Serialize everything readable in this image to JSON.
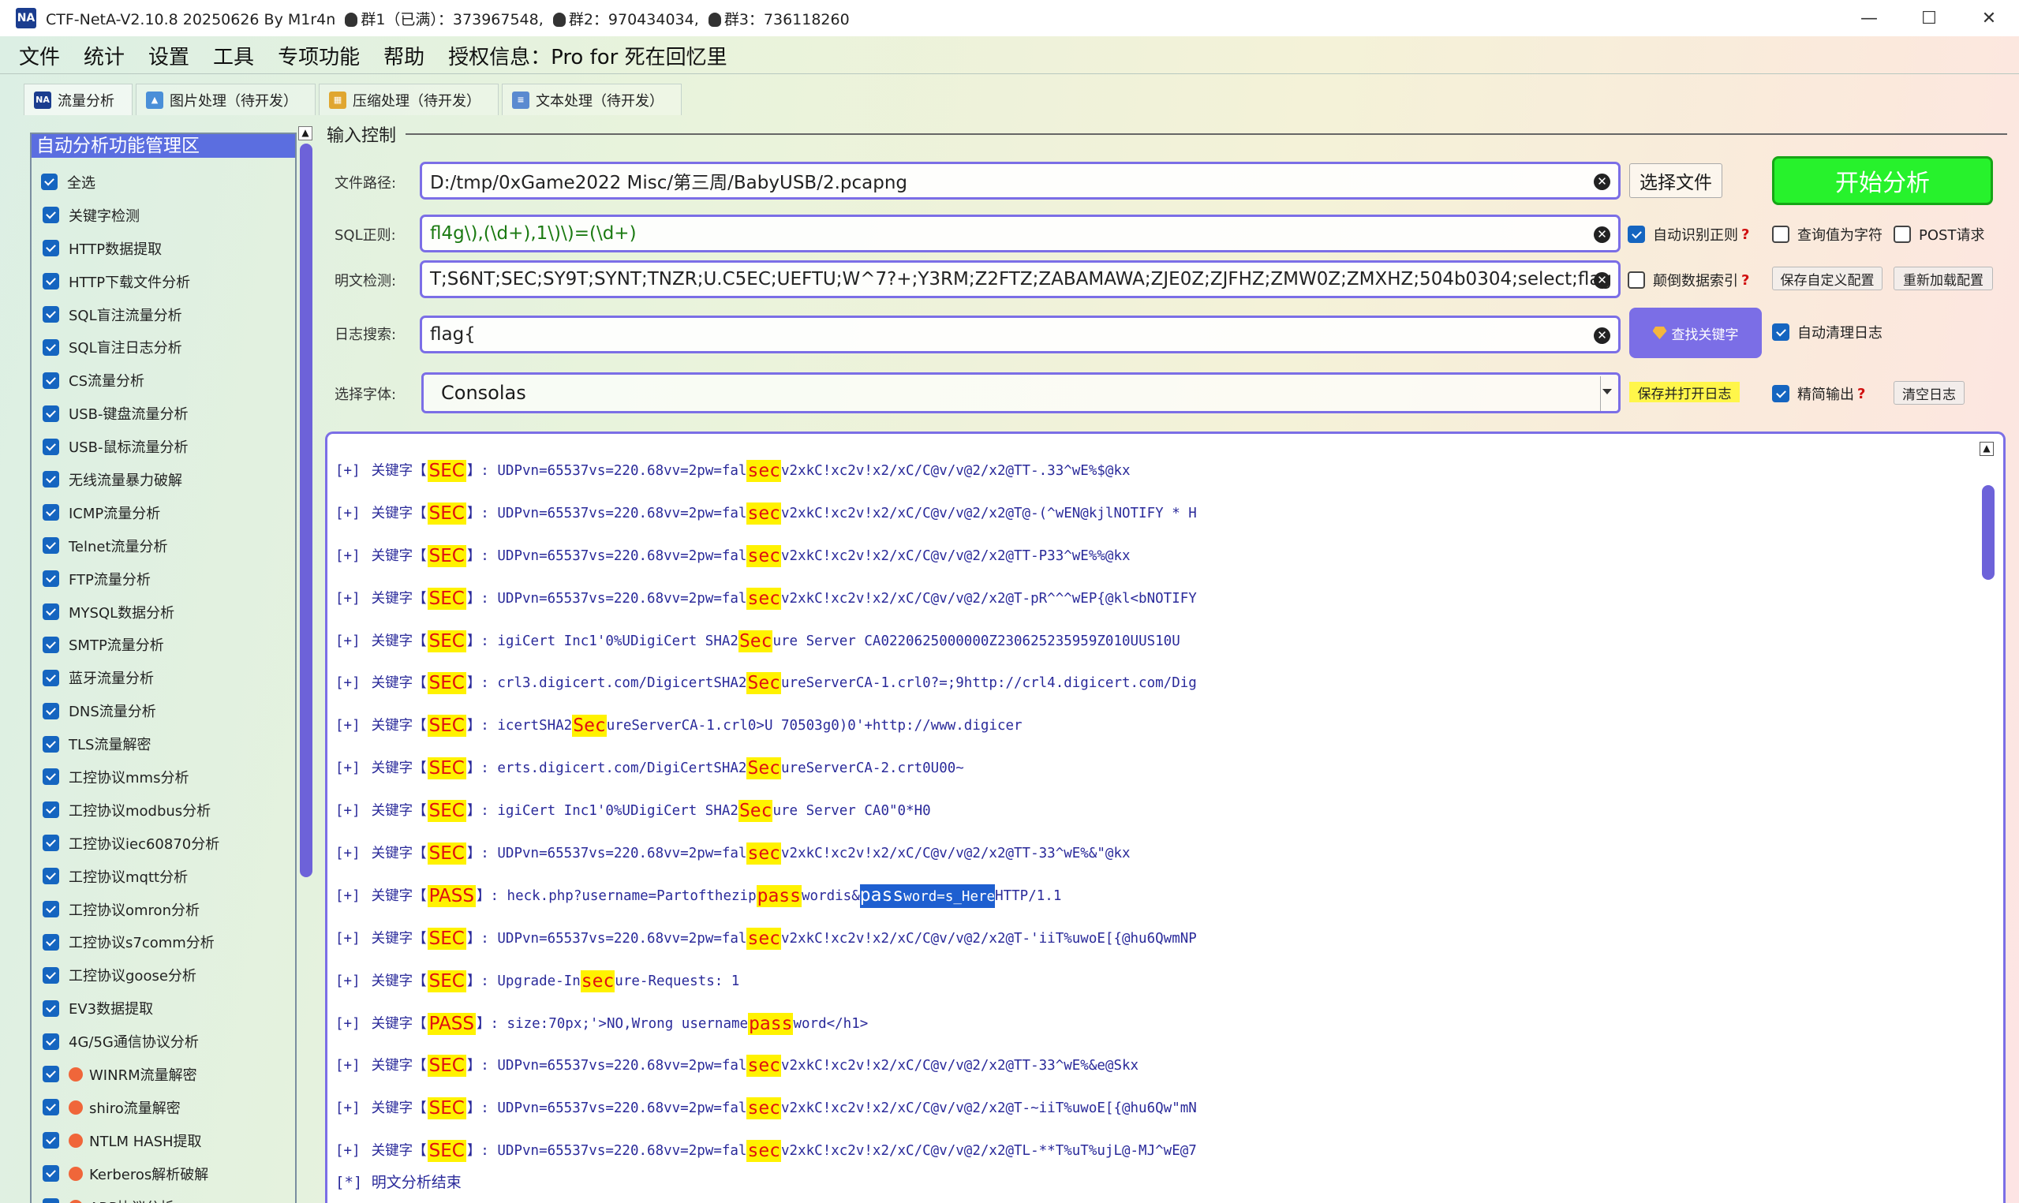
{
  "titlebar": {
    "logo": "NA",
    "title": "CTF-NetA-V2.10.8 20250626 By M1r4n",
    "group1": "群1（已满）：373967548,",
    "group2": "群2：970434034,",
    "group3": "群3：736118260",
    "minimize": "—",
    "maximize": "☐",
    "close": "✕"
  },
  "menu": [
    "文件",
    "统计",
    "设置",
    "工具",
    "专项功能",
    "帮助",
    "授权信息：Pro for 死在回忆里"
  ],
  "tabs": [
    {
      "label": "流量分析",
      "icon": "na-icon"
    },
    {
      "label": "图片处理（待开发）",
      "icon": "image-icon"
    },
    {
      "label": "压缩处理（待开发）",
      "icon": "archive-icon"
    },
    {
      "label": "文本处理（待开发）",
      "icon": "text-icon"
    }
  ],
  "sidebar": {
    "header": "自动分析功能管理区",
    "select_all": "全选",
    "items": [
      "关键字检测",
      "HTTP数据提取",
      "HTTP下载文件分析",
      "SQL盲注流量分析",
      "SQL盲注日志分析",
      "CS流量分析",
      "USB-键盘流量分析",
      "USB-鼠标流量分析",
      "无线流量暴力破解",
      "ICMP流量分析",
      "Telnet流量分析",
      "FTP流量分析",
      "MYSQL数据分析",
      "SMTP流量分析",
      "蓝牙流量分析",
      "DNS流量分析",
      "TLS流量解密",
      "工控协议mms分析",
      "工控协议modbus分析",
      "工控协议iec60870分析",
      "工控协议mqtt分析",
      "工控协议omron分析",
      "工控协议s7comm分析",
      "工控协议goose分析",
      "EV3数据提取",
      "4G/5G通信协议分析"
    ],
    "badge_items": [
      "WINRM流量解密",
      "shiro流量解密",
      "NTLM HASH提取",
      "Kerberos解析破解",
      "ARP协议分析"
    ]
  },
  "input_control": {
    "section_title": "输入控制",
    "file_path_label": "文件路径:",
    "file_path_value": "D:/tmp/0xGame2022 Misc/第三周/BabyUSB/2.pcapng",
    "choose_file": "选择文件",
    "start_analysis": "开始分析",
    "sql_label": "SQL正则:",
    "sql_value": "fl4g\\),(\\d+),1\\)\\)=(\\d+)",
    "auto_regex": "自动识别正则",
    "query_as_char": "查询值为字符",
    "post_request": "POST请求",
    "plain_label": "明文检测:",
    "plain_value": "T;S6NT;SEC;SY9T;SYNT;TNZR;U.C5EC;UEFTU;W^7?+;Y3RM;Z2FTZ;ZABAMAWA;ZJE0Z;ZJFHZ;ZMW0Z;ZMXHZ;504b0304;select;flag",
    "reverse_index": "颠倒数据索引",
    "save_custom": "保存自定义配置",
    "reload_config": "重新加载配置",
    "log_search_label": "日志搜索:",
    "log_search_value": "flag{",
    "find_keyword": "查找关键字",
    "auto_clear_log": "自动清理日志",
    "font_label": "选择字体:",
    "font_value": "Consolas",
    "save_open_log": "保存并打开日志",
    "concise_output": "精简输出",
    "clear_log": "清空日志"
  },
  "log": {
    "lines": [
      {
        "prefix": "[+]",
        "label": "关键字",
        "kw": "SEC",
        "a": "UDPvn=65537vs=220.68vv=2pw=fal",
        "h": "sec",
        "b": "v2xkC!xc2v!x2/xC/C@v/v@2/x2@TT-.33^wE%$@kx"
      },
      {
        "prefix": "[+]",
        "label": "关键字",
        "kw": "SEC",
        "a": "UDPvn=65537vs=220.68vv=2pw=fal",
        "h": "sec",
        "b": "v2xkC!xc2v!x2/xC/C@v/v@2/x2@T@-(^wEN@kjlNOTIFY * H"
      },
      {
        "prefix": "[+]",
        "label": "关键字",
        "kw": "SEC",
        "a": "UDPvn=65537vs=220.68vv=2pw=fal",
        "h": "sec",
        "b": "v2xkC!xc2v!x2/xC/C@v/v@2/x2@TT-P33^wE%%@kx"
      },
      {
        "prefix": "[+]",
        "label": "关键字",
        "kw": "SEC",
        "a": "UDPvn=65537vs=220.68vv=2pw=fal",
        "h": "sec",
        "b": "v2xkC!xc2v!x2/xC/C@v/v@2/x2@T-pR^^^wEP{@kl<bNOTIFY"
      },
      {
        "prefix": "[+]",
        "label": "关键字",
        "kw": "SEC",
        "a": "igiCert Inc1'0%UDigiCert SHA2 ",
        "h": "Sec",
        "b": "ure Server CA0220625000000Z230625235959Z010UUS10U"
      },
      {
        "prefix": "[+]",
        "label": "关键字",
        "kw": "SEC",
        "a": "crl3.digicert.com/DigicertSHA2",
        "h": "Sec",
        "b": "ureServerCA-1.crl0?=;9http://crl4.digicert.com/Dig"
      },
      {
        "prefix": "[+]",
        "label": "关键字",
        "kw": "SEC",
        "a": "icertSHA2",
        "h": "Sec",
        "b": "ureServerCA-1.crl0>U 70503g0)0'+http://www.digicer"
      },
      {
        "prefix": "[+]",
        "label": "关键字",
        "kw": "SEC",
        "a": "erts.digicert.com/DigiCertSHA2",
        "h": "Sec",
        "b": "ureServerCA-2.crt0U00~"
      },
      {
        "prefix": "[+]",
        "label": "关键字",
        "kw": "SEC",
        "a": "igiCert Inc1'0%UDigiCert SHA2 ",
        "h": "Sec",
        "b": "ure Server CA0\"0*H0"
      },
      {
        "prefix": "[+]",
        "label": "关键字",
        "kw": "SEC",
        "a": "UDPvn=65537vs=220.68vv=2pw=fal",
        "h": "sec",
        "b": "v2xkC!xc2v!x2/xC/C@v/v@2/x2@TT-33^wE%&\"@kx"
      },
      {
        "prefix": "[+]",
        "label": "关键字",
        "kw": "PASS",
        "a": "heck.php?username=Partofthezip",
        "h": "pass",
        "b": "wordis&",
        "sel_h": "pass",
        "sel_b": "word=s_Here",
        "c": " HTTP/1.1"
      },
      {
        "prefix": "[+]",
        "label": "关键字",
        "kw": "SEC",
        "a": "UDPvn=65537vs=220.68vv=2pw=fal",
        "h": "sec",
        "b": "v2xkC!xc2v!x2/xC/C@v/v@2/x2@T-'iiT%uwoE[{@hu6QwmNP"
      },
      {
        "prefix": "[+]",
        "label": "关键字",
        "kw": "SEC",
        "a": "Upgrade-In",
        "h": "sec",
        "b": "ure-Requests: 1"
      },
      {
        "prefix": "[+]",
        "label": "关键字",
        "kw": "PASS",
        "a": "size:70px;'>NO,Wrong username ",
        "h": "pass",
        "b": "word</h1>"
      },
      {
        "prefix": "[+]",
        "label": "关键字",
        "kw": "SEC",
        "a": "UDPvn=65537vs=220.68vv=2pw=fal",
        "h": "sec",
        "b": "v2xkC!xc2v!x2/xC/C@v/v@2/x2@TT-33^wE%&e@Skx"
      },
      {
        "prefix": "[+]",
        "label": "关键字",
        "kw": "SEC",
        "a": "UDPvn=65537vs=220.68vv=2pw=fal",
        "h": "sec",
        "b": "v2xkC!xc2v!x2/xC/C@v/v@2/x2@T-~iiT%uwoE[{@hu6Qw\"mN"
      },
      {
        "prefix": "[+]",
        "label": "关键字",
        "kw": "SEC",
        "a": "UDPvn=65537vs=220.68vv=2pw=fal",
        "h": "sec",
        "b": "v2xkC!xc2v!x2/xC/C@v/v@2/x2@TL-**T%uT%ujL@-MJ^wE@7"
      }
    ],
    "end_prefix": "[*]",
    "end_text": "明文分析结束"
  }
}
